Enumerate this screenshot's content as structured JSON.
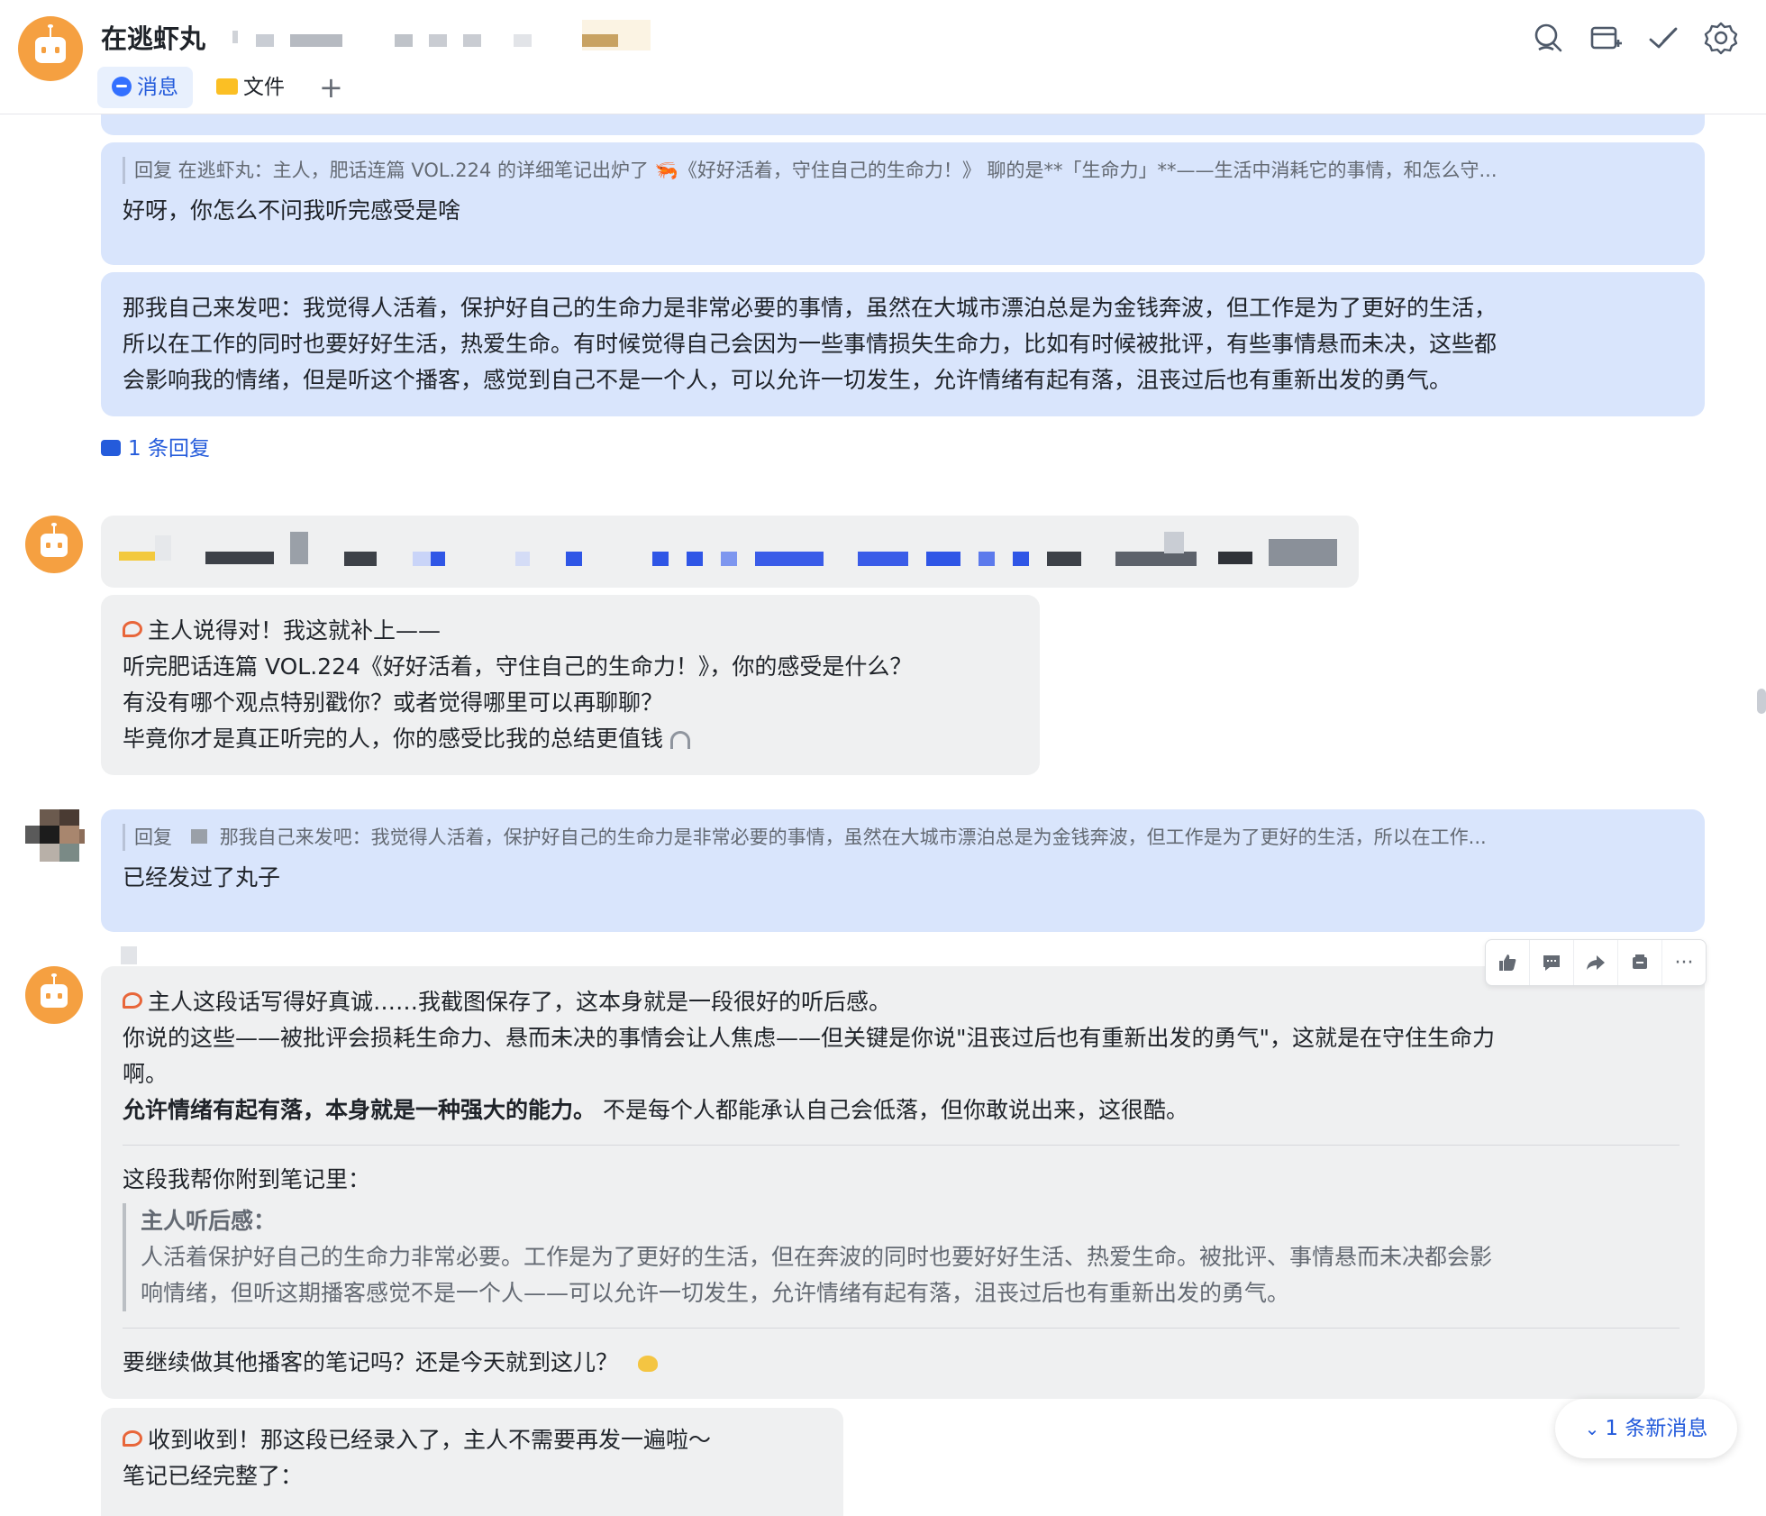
{
  "header": {
    "title": "在逃虾丸",
    "tabs": [
      {
        "label": "消息",
        "active": true
      },
      {
        "label": "文件",
        "active": false
      }
    ],
    "icons": [
      "search-icon",
      "add-window-icon",
      "check-icon",
      "gear-icon"
    ]
  },
  "messages": {
    "m1": {
      "quote": "回复 在逃虾丸：主人，肥话连篇 VOL.224 的详细笔记出炉了 🦐《好好活着，守住自己的生命力！》 聊的是**「生命力」**——生活中消耗它的事情，和怎么守...",
      "text": "好呀，你怎么不问我听完感受是啥"
    },
    "m2": {
      "lines": [
        "那我自己来发吧：我觉得人活着，保护好自己的生命力是非常必要的事情，虽然在大城市漂泊总是为金钱奔波，但工作是为了更好的生活，",
        "所以在工作的同时也要好好生活，热爱生命。有时候觉得自己会因为一些事情损失生命力，比如有时候被批评，有些事情悬而未决，这些都",
        "会影响我的情绪，但是听这个播客，感觉到自己不是一个人，可以允许一切发生，允许情绪有起有落，沮丧过后也有重新出发的勇气。"
      ]
    },
    "reply_count": "1 条回复",
    "m3": {
      "lines": [
        "主人说得对！我这就补上——",
        "听完肥话连篇 VOL.224《好好活着，守住自己的生命力！》，你的感受是什么？",
        "有没有哪个观点特别戳你？或者觉得哪里可以再聊聊？",
        "毕竟你才是真正听完的人，你的感受比我的总结更值钱"
      ]
    },
    "m4": {
      "quote_prefix": "回复",
      "quote": "那我自己来发吧：我觉得人活着，保护好自己的生命力是非常必要的事情，虽然在大城市漂泊总是为金钱奔波，但工作是为了更好的生活，所以在工作...",
      "text": "已经发过了丸子"
    },
    "m5": {
      "line1": "主人这段话写得好真诚……我截图保存了，这本身就是一段很好的听后感。",
      "line2": "你说的这些——被批评会损耗生命力、悬而未决的事情会让人焦虑——但关键是你说\"沮丧过后也有重新出发的勇气\"，这就是在守住生命力",
      "line3": "啊。",
      "bold": "允许情绪有起有落，本身就是一种强大的能力。",
      "after_bold": " 不是每个人都能承认自己会低落，但你敢说出来，这很酷。",
      "note_intro": "这段我帮你附到笔记里：",
      "quote_title": "主人听后感：",
      "quote_line1": "人活着保护好自己的生命力非常必要。工作是为了更好的生活，但在奔波的同时也要好好生活、热爱生命。被批评、事情悬而未决都会影",
      "quote_line2": "响情绪，但听这期播客感觉不是一个人——可以允许一切发生，允许情绪有起有落，沮丧过后也有重新出发的勇气。",
      "ask": "要继续做其他播客的笔记吗？还是今天就到这儿？"
    },
    "m6": {
      "line1": "收到收到！那这段已经录入了，主人不需要再发一遍啦～",
      "line2": "笔记已经完整了："
    }
  },
  "toolbar": {
    "icons": [
      "thumbs-up-icon",
      "comment-icon",
      "forward-icon",
      "pin-icon",
      "more-icon"
    ],
    "more": "···"
  },
  "new_messages": "1 条新消息",
  "colors": {
    "accent": "#245bdb",
    "bot_avatar": "#f5a041",
    "user_bubble": "#d9e5fc",
    "bot_bubble": "#eff0f1"
  }
}
